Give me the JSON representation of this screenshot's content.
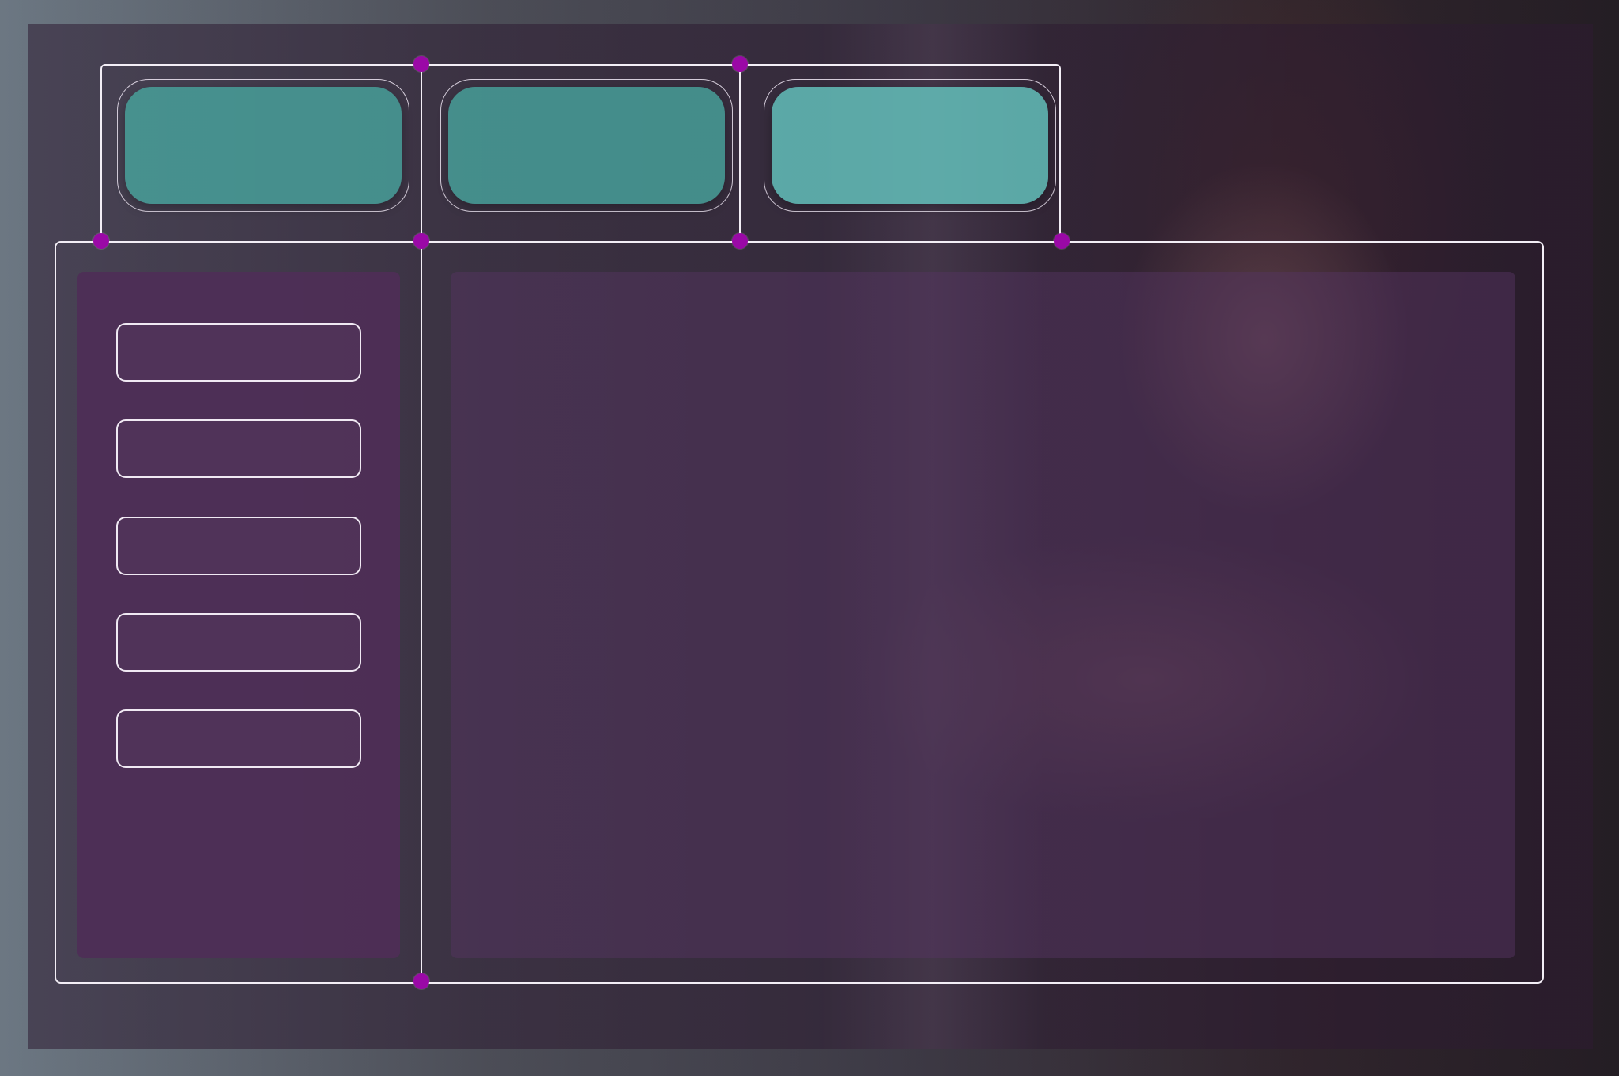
{
  "window": {
    "title": ""
  },
  "header": {
    "tabs": [
      {
        "label": ""
      },
      {
        "label": ""
      },
      {
        "label": ""
      }
    ]
  },
  "sidebar": {
    "items": [
      {
        "label": ""
      },
      {
        "label": ""
      },
      {
        "label": ""
      },
      {
        "label": ""
      },
      {
        "label": ""
      }
    ]
  },
  "main": {
    "content": ""
  },
  "colors": {
    "accent_teal": "#48a8a0",
    "accent_teal_light": "#64c4be",
    "panel_purple": "#4e2e56",
    "node_magenta": "#9a09a6",
    "wire": "#f3eef6"
  }
}
